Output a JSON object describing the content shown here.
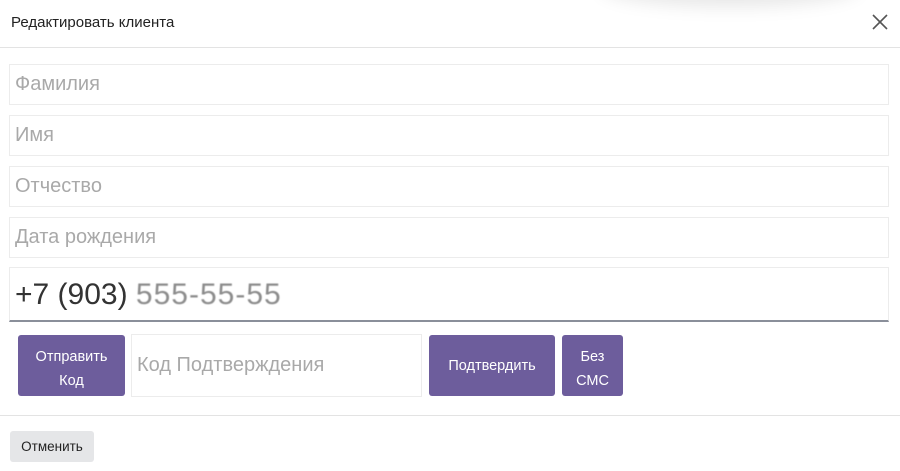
{
  "modal": {
    "title": "Редактировать клиента"
  },
  "form": {
    "last_name_placeholder": "Фамилия",
    "first_name_placeholder": "Имя",
    "middle_name_placeholder": "Отчество",
    "birth_date_placeholder": "Дата рождения",
    "phone_prefix": "+7 (903) ",
    "phone_masked": "555-55-55",
    "code_placeholder": "Код Подтверждения"
  },
  "buttons": {
    "send_code": "Отправить\nКод",
    "confirm": "Подтвердить",
    "no_sms": "Без\nСМС",
    "cancel": "Отменить"
  },
  "colors": {
    "accent": "#6d5d9c",
    "secondary_button": "#e5e6e8"
  },
  "icons": {
    "close": "close-icon"
  }
}
